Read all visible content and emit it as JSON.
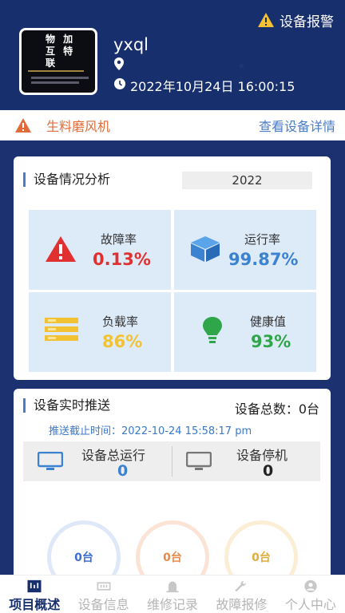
{
  "header": {
    "alarm_label": "设备报警",
    "avatar_logo_text": "物加互特联",
    "username": "yxql",
    "datetime": "2022年10月24日 16:00:15"
  },
  "device_bar": {
    "device_name": "生料磨风机",
    "detail_link": "查看设备详情"
  },
  "analysis": {
    "title": "设备情况分析",
    "year": "2022",
    "stats": [
      {
        "label": "故障率",
        "value": "0.13%",
        "color": "#e0302f",
        "icon": "warning-icon"
      },
      {
        "label": "运行率",
        "value": "99.87%",
        "color": "#3b82d0",
        "icon": "cube-icon"
      },
      {
        "label": "负载率",
        "value": "86%",
        "color": "#f2c233",
        "icon": "stack-icon"
      },
      {
        "label": "健康值",
        "value": "93%",
        "color": "#2fa64a",
        "icon": "bulb-icon"
      }
    ]
  },
  "push": {
    "title": "设备实时推送",
    "total_label": "设备总数：0台",
    "deadline": "推送截止时间：2022-10-24 15:58:17 pm",
    "running_label": "设备总运行",
    "running_value": "0",
    "stopped_label": "设备停机",
    "stopped_value": "0",
    "rings": [
      {
        "value": "0台",
        "color": "#3b6ed0",
        "border": "#dfe8f8"
      },
      {
        "value": "0台",
        "color": "#e58a4a",
        "border": "#fbe4d6"
      },
      {
        "value": "0台",
        "color": "#e0ac3a",
        "border": "#fbeed5"
      }
    ]
  },
  "nav": {
    "items": [
      {
        "label": "项目概述",
        "icon": "overview-icon",
        "active": true
      },
      {
        "label": "设备信息",
        "icon": "device-info-icon",
        "active": false
      },
      {
        "label": "维修记录",
        "icon": "repair-record-icon",
        "active": false
      },
      {
        "label": "故障报修",
        "icon": "wrench-icon",
        "active": false
      },
      {
        "label": "个人中心",
        "icon": "user-icon",
        "active": false
      }
    ]
  },
  "colors": {
    "header_bg": "#182f6e",
    "accent_blue": "#4a7cc7",
    "device_name": "#e06c3a"
  }
}
